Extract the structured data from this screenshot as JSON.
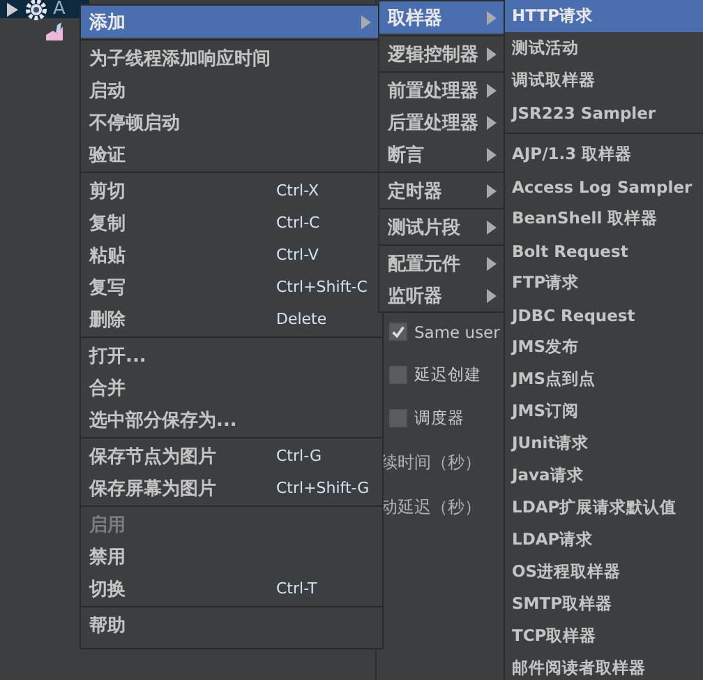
{
  "tree": [
    {
      "label": "A",
      "expanded": true,
      "kind": "gear"
    },
    {
      "kind": "chart"
    }
  ],
  "form": {
    "checkboxes": [
      {
        "label": "Same user",
        "checked": true
      },
      {
        "label": "延迟创建",
        "checked": false
      },
      {
        "label": "调度器",
        "checked": false
      }
    ],
    "fields": [
      "续时间（秒）",
      "动延迟（秒）"
    ]
  },
  "menus": [
    {
      "items": [
        {
          "kind": "item",
          "label": "添加",
          "selected": true,
          "submenu": true
        },
        {
          "kind": "separator"
        },
        {
          "kind": "item",
          "label": "为子线程添加响应时间",
          "selected": false,
          "submenu": false
        },
        {
          "kind": "item",
          "label": "启动",
          "selected": false,
          "submenu": false
        },
        {
          "kind": "item",
          "label": "不停顿启动",
          "selected": false,
          "submenu": false
        },
        {
          "kind": "item",
          "label": "验证",
          "selected": false,
          "submenu": false
        },
        {
          "kind": "separator"
        },
        {
          "kind": "item",
          "label": "剪切",
          "shortcut": "Ctrl-X",
          "selected": false,
          "submenu": false
        },
        {
          "kind": "item",
          "label": "复制",
          "shortcut": "Ctrl-C",
          "selected": false,
          "submenu": false
        },
        {
          "kind": "item",
          "label": "粘贴",
          "shortcut": "Ctrl-V",
          "selected": false,
          "submenu": false
        },
        {
          "kind": "item",
          "label": "复写",
          "shortcut": "Ctrl+Shift-C",
          "selected": false,
          "submenu": false
        },
        {
          "kind": "item",
          "label": "删除",
          "shortcut": "Delete",
          "selected": false,
          "submenu": false
        },
        {
          "kind": "separator"
        },
        {
          "kind": "item",
          "label": "打开...",
          "selected": false,
          "submenu": false
        },
        {
          "kind": "item",
          "label": "合并",
          "selected": false,
          "submenu": false
        },
        {
          "kind": "item",
          "label": "选中部分保存为...",
          "selected": false,
          "submenu": false
        },
        {
          "kind": "separator"
        },
        {
          "kind": "item",
          "label": "保存节点为图片",
          "shortcut": "Ctrl-G",
          "selected": false,
          "submenu": false
        },
        {
          "kind": "item",
          "label": "保存屏幕为图片",
          "shortcut": "Ctrl+Shift-G",
          "selected": false,
          "submenu": false
        },
        {
          "kind": "separator"
        },
        {
          "kind": "item",
          "label": "启用",
          "selected": false,
          "submenu": false,
          "disabled": true
        },
        {
          "kind": "item",
          "label": "禁用",
          "selected": false,
          "submenu": false,
          "disabled": false
        },
        {
          "kind": "item",
          "label": "切换",
          "shortcut": "Ctrl-T",
          "selected": false,
          "submenu": false,
          "disabled": false
        },
        {
          "kind": "separator"
        },
        {
          "kind": "item",
          "label": "帮助",
          "selected": false,
          "submenu": false
        }
      ]
    },
    {
      "items": [
        {
          "kind": "item",
          "label": "取样器",
          "selected": true,
          "submenu": true
        },
        {
          "kind": "separator"
        },
        {
          "kind": "item",
          "label": "逻辑控制器",
          "selected": false,
          "submenu": true
        },
        {
          "kind": "separator"
        },
        {
          "kind": "item",
          "label": "前置处理器",
          "selected": false,
          "submenu": true
        },
        {
          "kind": "item",
          "label": "后置处理器",
          "selected": false,
          "submenu": true
        },
        {
          "kind": "item",
          "label": "断言",
          "selected": false,
          "submenu": true
        },
        {
          "kind": "separator"
        },
        {
          "kind": "item",
          "label": "定时器",
          "selected": false,
          "submenu": true
        },
        {
          "kind": "separator"
        },
        {
          "kind": "item",
          "label": "测试片段",
          "selected": false,
          "submenu": true
        },
        {
          "kind": "separator"
        },
        {
          "kind": "item",
          "label": "配置元件",
          "selected": false,
          "submenu": true
        },
        {
          "kind": "item",
          "label": "监听器",
          "selected": false,
          "submenu": true
        }
      ]
    },
    {
      "items": [
        {
          "kind": "item",
          "label": "HTTP请求",
          "selected": true,
          "submenu": false
        },
        {
          "kind": "item",
          "label": "测试活动",
          "selected": false,
          "submenu": false
        },
        {
          "kind": "item",
          "label": "调试取样器",
          "selected": false,
          "submenu": false
        },
        {
          "kind": "item",
          "label": "JSR223 Sampler",
          "selected": false,
          "submenu": false
        },
        {
          "kind": "separator"
        },
        {
          "kind": "item",
          "label": "AJP/1.3 取样器",
          "selected": false,
          "submenu": false
        },
        {
          "kind": "item",
          "label": "Access Log Sampler",
          "selected": false,
          "submenu": false
        },
        {
          "kind": "item",
          "label": "BeanShell 取样器",
          "selected": false,
          "submenu": false
        },
        {
          "kind": "item",
          "label": "Bolt Request",
          "selected": false,
          "submenu": false
        },
        {
          "kind": "item",
          "label": "FTP请求",
          "selected": false,
          "submenu": false
        },
        {
          "kind": "item",
          "label": "JDBC Request",
          "selected": false,
          "submenu": false
        },
        {
          "kind": "item",
          "label": "JMS发布",
          "selected": false,
          "submenu": false
        },
        {
          "kind": "item",
          "label": "JMS点到点",
          "selected": false,
          "submenu": false
        },
        {
          "kind": "item",
          "label": "JMS订阅",
          "selected": false,
          "submenu": false
        },
        {
          "kind": "item",
          "label": "JUnit请求",
          "selected": false,
          "submenu": false
        },
        {
          "kind": "item",
          "label": "Java请求",
          "selected": false,
          "submenu": false
        },
        {
          "kind": "item",
          "label": "LDAP扩展请求默认值",
          "selected": false,
          "submenu": false
        },
        {
          "kind": "item",
          "label": "LDAP请求",
          "selected": false,
          "submenu": false
        },
        {
          "kind": "item",
          "label": "OS进程取样器",
          "selected": false,
          "submenu": false
        },
        {
          "kind": "item",
          "label": "SMTP取样器",
          "selected": false,
          "submenu": false
        },
        {
          "kind": "item",
          "label": "TCP取样器",
          "selected": false,
          "submenu": false
        },
        {
          "kind": "item",
          "label": "邮件阅读者取样器",
          "selected": false,
          "submenu": false
        }
      ]
    }
  ]
}
